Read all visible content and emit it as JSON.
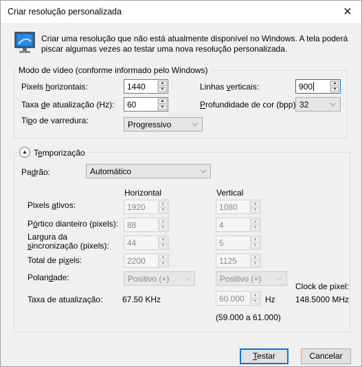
{
  "window": {
    "title": "Criar resolução personalizada",
    "close_glyph": "✕"
  },
  "intro": {
    "icon": "monitor-icon",
    "text": "Criar uma resolução que não está atualmente disponível no Windows. A tela poderá piscar algumas vezes ao testar uma nova resolução personalizada."
  },
  "video_mode": {
    "legend": "Modo de vídeo (conforme informado pelo Windows)",
    "horizontal_pixels": {
      "label_pre": "Pixels ",
      "label_u": "h",
      "label_post": "orizontais:",
      "value": "1440"
    },
    "vertical_lines": {
      "label_pre": "Linhas ",
      "label_u": "v",
      "label_post": "erticais:",
      "value": "900"
    },
    "refresh_rate": {
      "label_pre": "Taxa ",
      "label_u": "d",
      "label_post": "e atualização (Hz):",
      "value": "60"
    },
    "color_depth": {
      "label_pre": "",
      "label_u": "P",
      "label_post": "rofundidade de cor (bpp):",
      "value": "32"
    },
    "scan_type": {
      "label_pre": "Ti",
      "label_u": "p",
      "label_post": "o de varredura:",
      "value": "Progressivo"
    }
  },
  "timing": {
    "legend_pre": "T",
    "legend_u": "e",
    "legend_post": "mporização",
    "collapse_glyph": "▲",
    "standard": {
      "label_pre": "Pa",
      "label_u": "d",
      "label_post": "rão:",
      "value": "Automático"
    },
    "col_horizontal": "Horizontal",
    "col_vertical": "Vertical",
    "rows": [
      {
        "label_pre": "Pixels ",
        "label_u": "a",
        "label_post": "tivos:",
        "h": "1920",
        "v": "1080"
      },
      {
        "label_pre": "P",
        "label_u": "ó",
        "label_post": "rtico dianteiro (pixels):",
        "h": "88",
        "v": "4"
      },
      {
        "label_pre": "Largura da ",
        "label_u": "s",
        "label_post": "incronização (pixels):",
        "h": "44",
        "v": "5"
      },
      {
        "label_pre": "Total de pi",
        "label_u": "x",
        "label_post": "els:",
        "h": "2200",
        "v": "1125"
      }
    ],
    "polarity": {
      "label_pre": "Polari",
      "label_u": "d",
      "label_post": "ade:",
      "h": "Positivo (+)",
      "v": "Positivo (+)"
    },
    "refresh": {
      "label": "Taxa de atualização:",
      "h_value": "67.50 KHz",
      "v_value": "60.000",
      "unit": "Hz",
      "range": "(59.000 a 61.000)"
    },
    "pixel_clock": {
      "label": "Clock de pixel:",
      "value": "148.5000 MHz"
    }
  },
  "buttons": {
    "test_pre": "",
    "test_u": "T",
    "test_post": "estar",
    "cancel": "Cancelar"
  }
}
